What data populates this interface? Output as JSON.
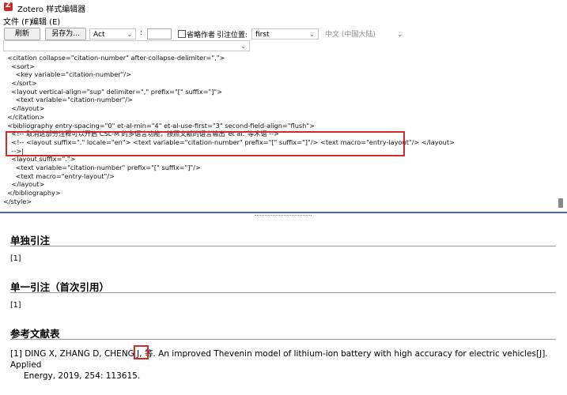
{
  "window": {
    "title": "Zotero 样式编辑器"
  },
  "menu": {
    "file": "文件 (F)",
    "edit": "编辑 (E)"
  },
  "toolbar": {
    "refresh_label": "刷新",
    "save_as_label": "另存为...",
    "style_select_value": "Act",
    "colon": ":",
    "omit_author_label": "省略作者",
    "locator_label": "引注位置:",
    "locator_select_value": "first",
    "locale_select_value": "中文 (中国大陆)"
  },
  "code_lines": [
    "  <citation collapse=\"citation-number\" after-collapse-delimiter=\",\">",
    "    <sort>",
    "      <key variable=\"citation-number\"/>",
    "    </sort>",
    "    <layout vertical-align=\"sup\" delimiter=\",\" prefix=\"[\" suffix=\"]\">",
    "      <text variable=\"citation-number\"/>",
    "    </layout>",
    "  </citation>",
    "  <bibliography entry-spacing=\"0\" et-al-min=\"4\" et-al-use-first=\"3\" second-field-align=\"flush\">",
    "    <!-- 取消这部分注释可以开启 CSL-M 的多语言功能，按照文献的语言输出\"et al.\"等术语 -->",
    "    <!-- <layout suffix=\".\" locale=\"en\"> <text variable=\"citation-number\" prefix=\"[\" suffix=\"]\"/> <text macro=\"entry-layout\"/> </layout>",
    "    -->|",
    "    <layout suffix=\".\">",
    "      <text variable=\"citation-number\" prefix=\"[\" suffix=\"]\"/>",
    "      <text macro=\"entry-layout\"/>",
    "    </layout>",
    "  </bibliography>",
    "</style>"
  ],
  "preview": {
    "single_heading": "单独引注",
    "single_value": "[1]",
    "first_heading": "单一引注（首次引用）",
    "first_value": "[1]",
    "bib_heading": "参考文献表",
    "bib_number": "[1]",
    "bib_authors": "DING X, ZHANG D, CHENG J,",
    "bib_etal": "等.",
    "bib_rest": "An improved Thevenin model of lithium-ion battery with high accuracy for electric vehicles[J]. Applied",
    "bib_line2": "Energy, 2019, 254: 113615."
  }
}
